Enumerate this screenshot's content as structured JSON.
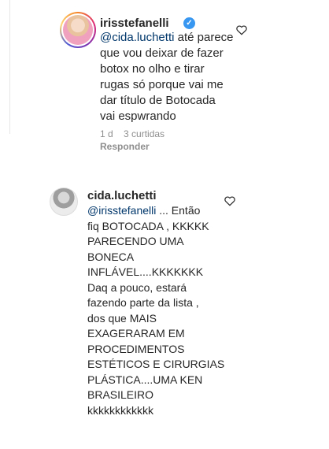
{
  "comments": [
    {
      "username": "irisstefanelli",
      "verified": true,
      "mention": "@cida.luchetti",
      "text_lines": [
        " até parece",
        "que vou deixar de fazer",
        "botox no olho e tirar",
        "rugas só porque vai me",
        "dar título de Botocada",
        "vai espwrando"
      ],
      "time": "1 d",
      "likes": "3 curtidas",
      "reply_label": "Responder"
    },
    {
      "username": "cida.luchetti",
      "verified": false,
      "mention": "@irisstefanelli",
      "text_lines": [
        " ... Então",
        "fiq BOTOCADA , KKKKK",
        "PARECENDO UMA",
        "BONECA",
        "INFLÁVEL....KKKKKKK",
        "Daq a pouco, estará",
        "fazendo parte da lista ,",
        "dos que MAIS",
        "EXAGERARAM EM",
        "PROCEDIMENTOS",
        "ESTÉTICOS E CIRURGIAS",
        "PLÁSTICA....UMA KEN",
        "BRASILEIRO",
        "kkkkkkkkkkkk"
      ]
    }
  ],
  "icons": {
    "like": "heart-outline-icon",
    "verified": "verified-badge-icon"
  },
  "colors": {
    "mention": "#00376b",
    "verified": "#3897f0",
    "meta": "#8e8e8e"
  }
}
